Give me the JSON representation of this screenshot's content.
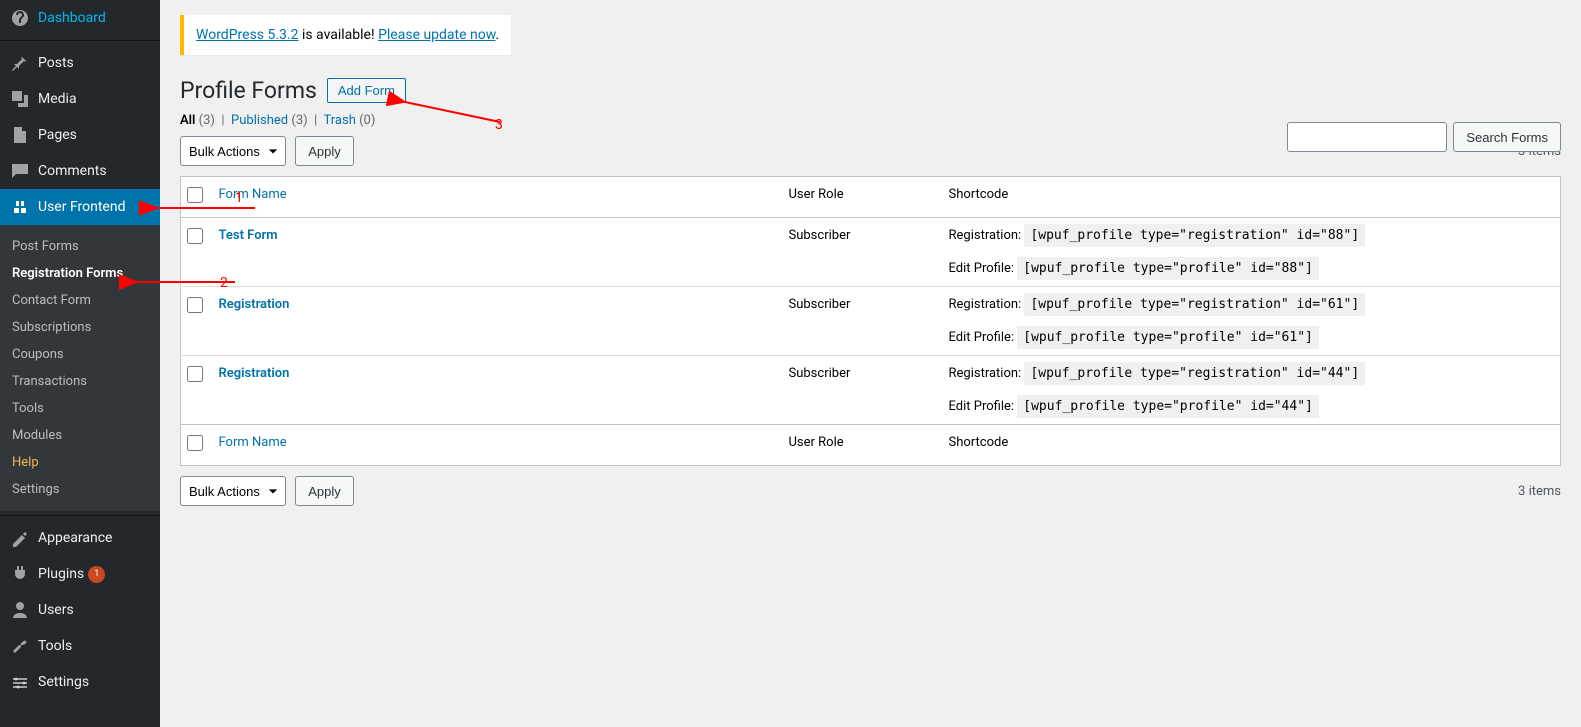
{
  "sidebar": {
    "dashboard": "Dashboard",
    "posts": "Posts",
    "media": "Media",
    "pages": "Pages",
    "comments": "Comments",
    "user_frontend": "User Frontend",
    "submenu": {
      "post_forms": "Post Forms",
      "registration_forms": "Registration Forms",
      "contact_form": "Contact Form",
      "subscriptions": "Subscriptions",
      "coupons": "Coupons",
      "transactions": "Transactions",
      "tools": "Tools",
      "modules": "Modules",
      "help": "Help",
      "settings": "Settings"
    },
    "appearance": "Appearance",
    "plugins": "Plugins",
    "plugins_count": "1",
    "users": "Users",
    "tools": "Tools",
    "settings": "Settings"
  },
  "notice": {
    "prefix": "WordPress 5.3.2",
    "middle": " is available! ",
    "link": "Please update now",
    "suffix": "."
  },
  "page": {
    "title": "Profile Forms",
    "add_button": "Add Form"
  },
  "filters": {
    "all_label": "All",
    "all_count": "(3)",
    "published_label": "Published",
    "published_count": "(3)",
    "trash_label": "Trash",
    "trash_count": "(0)"
  },
  "bulk": {
    "placeholder": "Bulk Actions",
    "apply": "Apply"
  },
  "items_text": "3 items",
  "search": {
    "button": "Search Forms"
  },
  "table": {
    "col_name": "Form Name",
    "col_role": "User Role",
    "col_shortcode": "Shortcode",
    "reg_label": "Registration: ",
    "edit_label": "Edit Profile: ",
    "rows": [
      {
        "name": "Test Form",
        "role": "Subscriber",
        "reg_code": "[wpuf_profile type=\"registration\" id=\"88\"]",
        "edit_code": "[wpuf_profile type=\"profile\" id=\"88\"]"
      },
      {
        "name": "Registration",
        "role": "Subscriber",
        "reg_code": "[wpuf_profile type=\"registration\" id=\"61\"]",
        "edit_code": "[wpuf_profile type=\"profile\" id=\"61\"]"
      },
      {
        "name": "Registration",
        "role": "Subscriber",
        "reg_code": "[wpuf_profile type=\"registration\" id=\"44\"]",
        "edit_code": "[wpuf_profile type=\"profile\" id=\"44\"]"
      }
    ]
  },
  "annotations": {
    "1": "1",
    "2": "2",
    "3": "3"
  }
}
